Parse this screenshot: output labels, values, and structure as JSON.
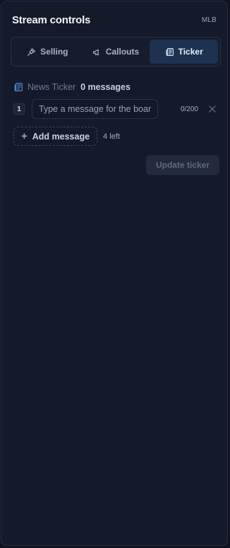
{
  "header": {
    "title": "Stream controls",
    "league": "MLB"
  },
  "tabs": [
    {
      "label": "Selling",
      "icon": "gavel-icon",
      "active": false
    },
    {
      "label": "Callouts",
      "icon": "megaphone-icon",
      "active": false
    },
    {
      "label": "Ticker",
      "icon": "newspaper-icon",
      "active": true
    }
  ],
  "ticker": {
    "section_label": "News Ticker",
    "message_count": "0 messages",
    "messages": [
      {
        "index": "1",
        "value": "",
        "placeholder": "Type a message for the board",
        "char_count": "0/200"
      }
    ],
    "add_label": "Add message",
    "remaining": "4 left",
    "update_label": "Update ticker"
  },
  "colors": {
    "panel_bg": "#141a29",
    "active_tab_bg": "#1d3250",
    "accent_icon": "#4b8fd6",
    "disabled_button_bg": "#222a3b"
  }
}
